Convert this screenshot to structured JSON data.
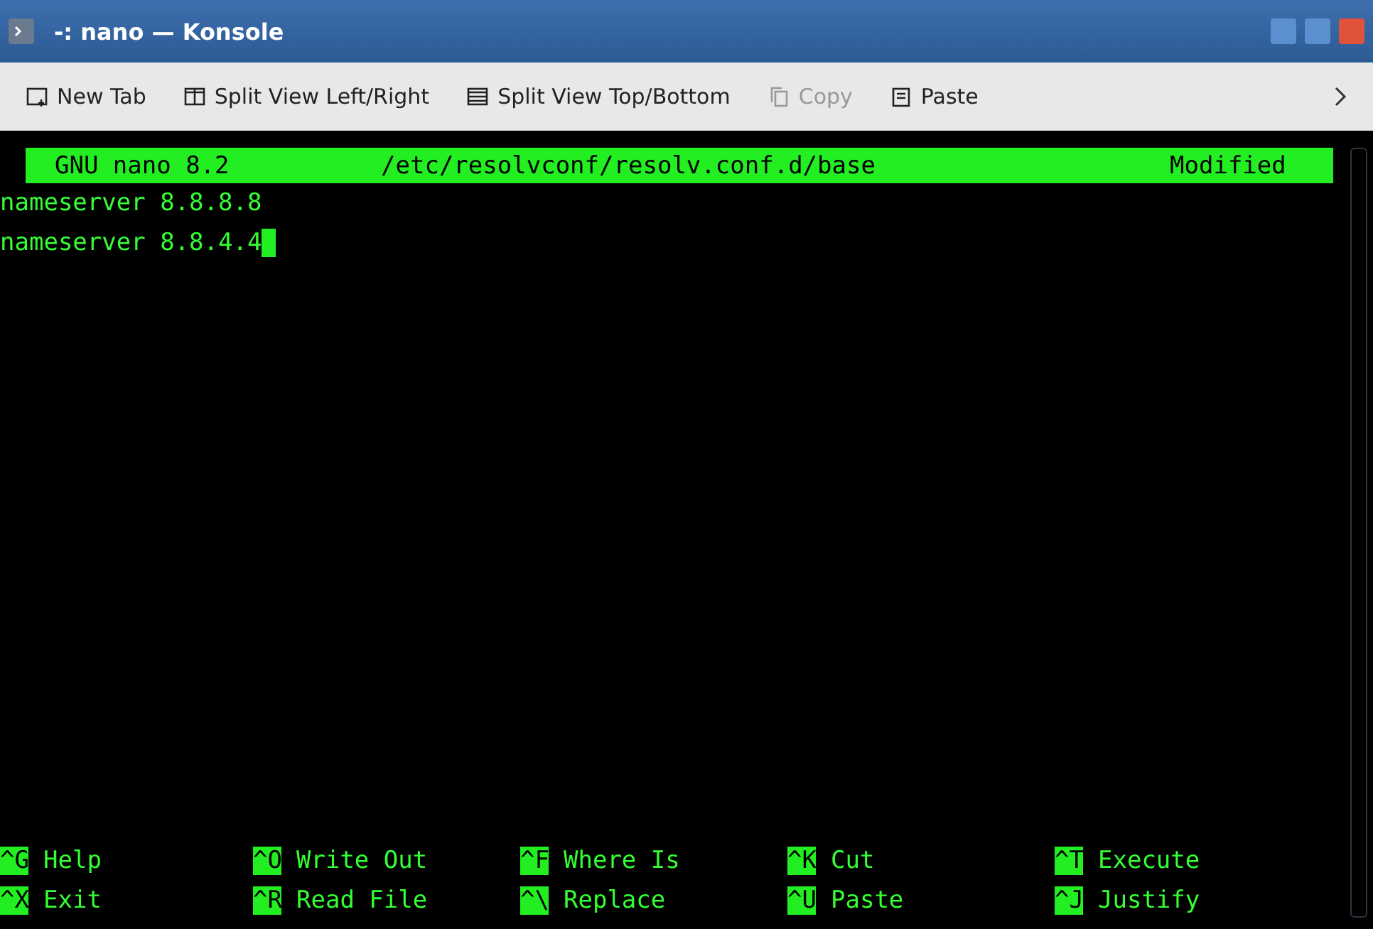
{
  "window": {
    "title": "-: nano — Konsole"
  },
  "toolbar": [
    {
      "label": "New Tab",
      "kind": "new-tab",
      "disabled": false
    },
    {
      "label": "Split View Left/Right",
      "kind": "split-lr",
      "disabled": false
    },
    {
      "label": "Split View Top/Bottom",
      "kind": "split-tb",
      "disabled": false
    },
    {
      "label": "Copy",
      "kind": "copy",
      "disabled": true
    },
    {
      "label": "Paste",
      "kind": "paste",
      "disabled": false
    }
  ],
  "nano": {
    "header": {
      "version": "GNU nano 8.2",
      "file": "/etc/resolvconf/resolv.conf.d/base",
      "status": "Modified"
    },
    "lines": [
      "nameserver 8.8.8.8",
      "nameserver 8.8.4.4"
    ],
    "shortcuts": [
      [
        {
          "key": "^G",
          "label": "Help"
        },
        {
          "key": "^X",
          "label": "Exit"
        }
      ],
      [
        {
          "key": "^O",
          "label": "Write Out"
        },
        {
          "key": "^R",
          "label": "Read File"
        }
      ],
      [
        {
          "key": "^F",
          "label": "Where Is"
        },
        {
          "key": "^\\",
          "label": "Replace"
        }
      ],
      [
        {
          "key": "^K",
          "label": "Cut"
        },
        {
          "key": "^U",
          "label": "Paste"
        }
      ],
      [
        {
          "key": "^T",
          "label": "Execute"
        },
        {
          "key": "^J",
          "label": "Justify"
        }
      ]
    ]
  }
}
